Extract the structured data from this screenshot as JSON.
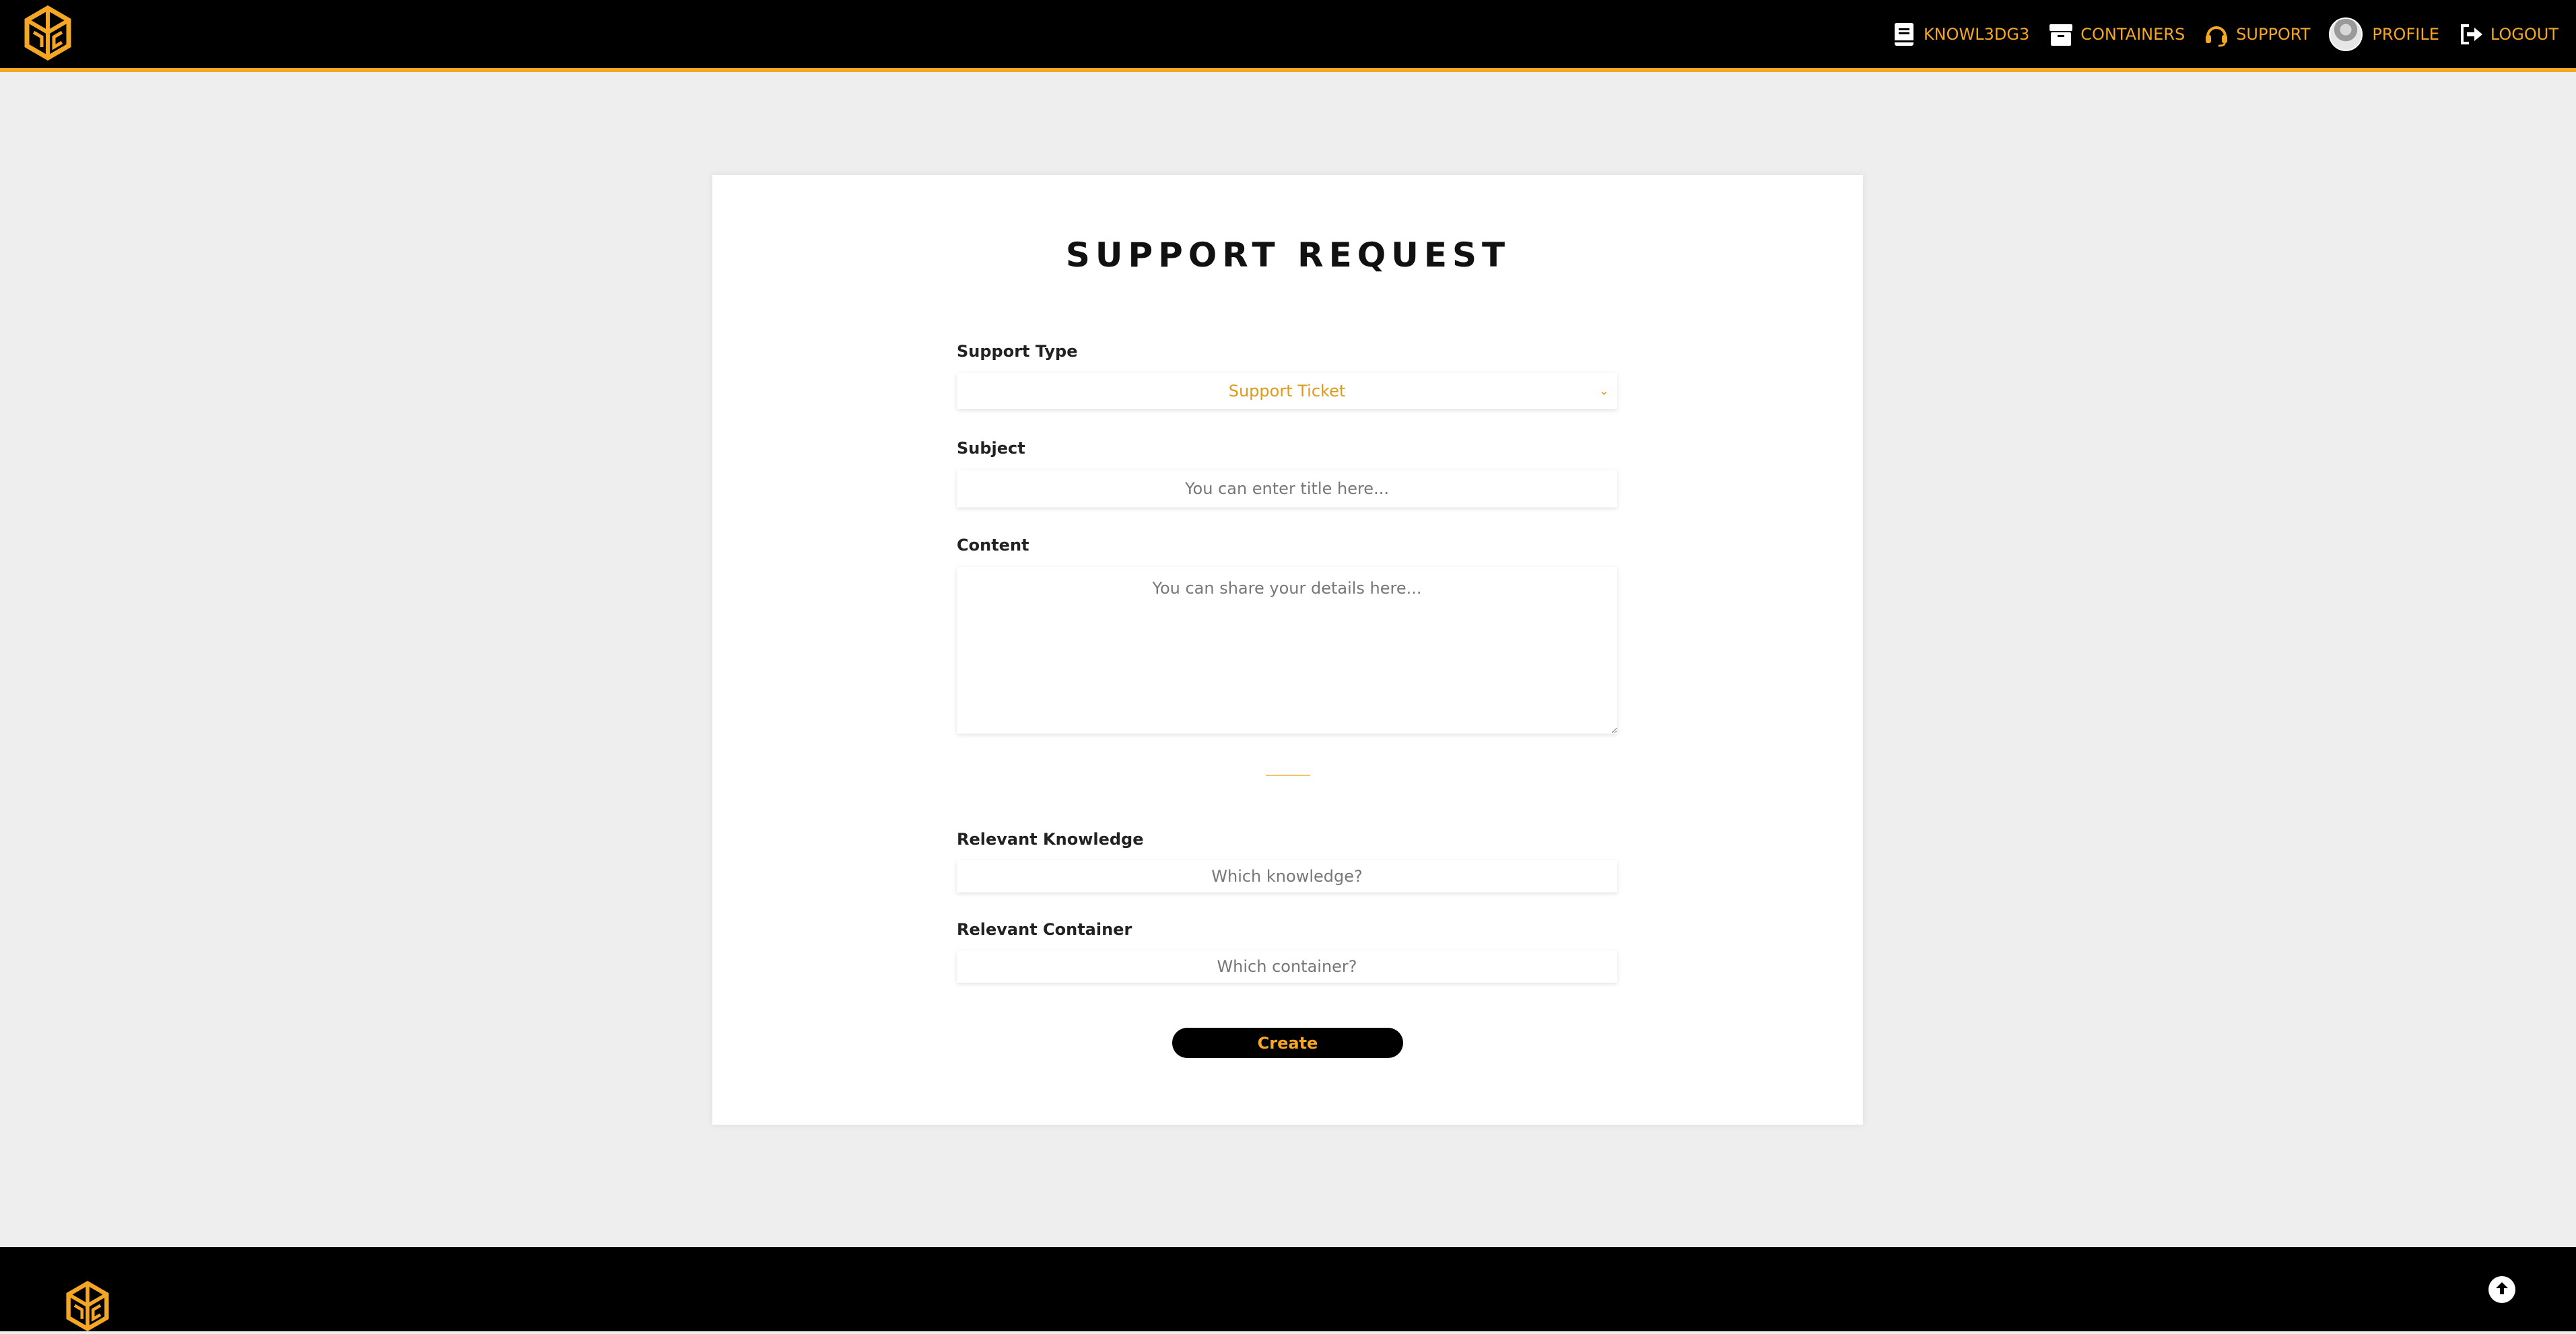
{
  "header": {
    "logo": "knowledge-cube-logo",
    "nav": [
      {
        "label": "KNOWL3DG3",
        "icon": "book-icon"
      },
      {
        "label": "CONTAINERS",
        "icon": "box-icon"
      },
      {
        "label": "SUPPORT",
        "icon": "headset-icon"
      },
      {
        "label": "PROFILE",
        "icon": "avatar"
      },
      {
        "label": "LOGOUT",
        "icon": "logout-icon"
      }
    ]
  },
  "form": {
    "title": "SUPPORT REQUEST",
    "support_type": {
      "label": "Support Type",
      "value": "Support Ticket"
    },
    "subject": {
      "label": "Subject",
      "placeholder": "You can enter title here..."
    },
    "content": {
      "label": "Content",
      "placeholder": "You can share your details here..."
    },
    "knowledge": {
      "label": "Relevant Knowledge",
      "placeholder": "Which knowledge?"
    },
    "container": {
      "label": "Relevant Container",
      "placeholder": "Which container?"
    },
    "submit_label": "Create"
  },
  "colors": {
    "accent": "#f5a623",
    "header_bg": "#000000",
    "page_bg": "#efeeef"
  }
}
